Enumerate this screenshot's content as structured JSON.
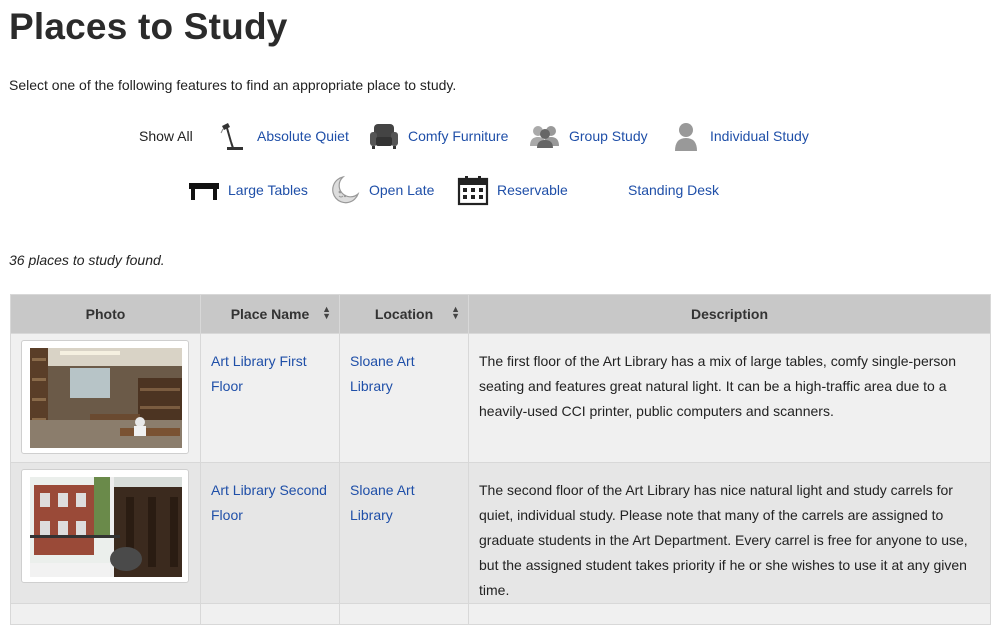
{
  "page": {
    "title": "Places to Study",
    "intro": "Select one of the following features to find an appropriate place to study.",
    "results_count": "36 places to study found."
  },
  "filters": [
    {
      "label": "Show All",
      "icon": "none"
    },
    {
      "label": "Absolute Quiet",
      "icon": "desk-lamp-icon"
    },
    {
      "label": "Comfy Furniture",
      "icon": "armchair-icon"
    },
    {
      "label": "Group Study",
      "icon": "group-icon"
    },
    {
      "label": "Individual Study",
      "icon": "person-icon"
    },
    {
      "label": "Large Tables",
      "icon": "table-icon"
    },
    {
      "label": "Open Late",
      "icon": "moon-icon"
    },
    {
      "label": "Reservable",
      "icon": "calendar-icon"
    },
    {
      "label": "Standing Desk",
      "icon": "none"
    }
  ],
  "table": {
    "columns": [
      "Photo",
      "Place Name",
      "Location",
      "Description"
    ],
    "rows": [
      {
        "place_name": "Art Library First Floor",
        "location": "Sloane Art Library",
        "description": "The first floor of the Art Library has a mix of large tables, comfy single-person seating and features great natural light. It can be a high-traffic area due to a heavily-used CCI printer, public computers and scanners."
      },
      {
        "place_name": "Art Library Second Floor",
        "location": "Sloane Art Library",
        "description": "The second floor of the Art Library has nice natural light and study carrels for quiet, individual study. Please note that many of the carrels are assigned to graduate students in the Art Department. Every carrel is free for anyone to use, but the assigned student takes priority if he or she wishes to use it at any given time."
      }
    ]
  },
  "colors": {
    "link": "#1f4fa8",
    "header_bg": "#c8c8c8",
    "row_odd": "#f0f0f0",
    "row_even": "#e6e6e6"
  }
}
